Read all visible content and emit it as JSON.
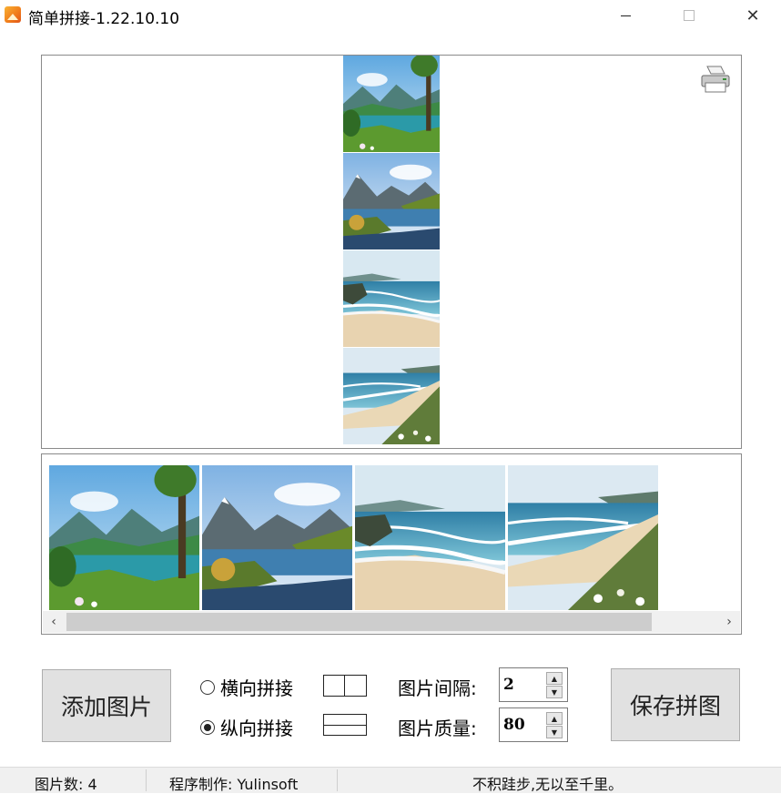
{
  "window": {
    "title": "简单拼接-1.22.10.10",
    "controls": {
      "minimize_icon": "minimize-icon",
      "maximize_icon": "maximize-icon",
      "close_icon": "close-icon",
      "close_glyph": "✕"
    }
  },
  "preview": {
    "print_icon": "printer-icon",
    "tiles": [
      {
        "name": "lake-with-trees"
      },
      {
        "name": "mountain-river"
      },
      {
        "name": "beach-waves"
      },
      {
        "name": "coastal-beach"
      }
    ]
  },
  "thumbnails": {
    "items": [
      {
        "name": "lake-with-trees"
      },
      {
        "name": "mountain-river"
      },
      {
        "name": "beach-waves"
      },
      {
        "name": "coastal-beach"
      }
    ],
    "scroll_left": "‹",
    "scroll_right": "›"
  },
  "controls": {
    "add_button": "添加图片",
    "save_button": "保存拼图",
    "horizontal_label": "横向拼接",
    "vertical_label": "纵向拼接",
    "selected_mode": "vertical",
    "gap_label": "图片间隔:",
    "gap_value": "2",
    "quality_label": "图片质量:",
    "quality_value": "80",
    "spin_up": "▲",
    "spin_down": "▼"
  },
  "status": {
    "count": "图片数: 4",
    "author": "程序制作: Yulinsoft",
    "motto": "不积跬步,无以至千里。"
  },
  "colors": {
    "accent": "#f07a1a",
    "button_face": "#e1e1e1",
    "status_bg": "#f0f0f0"
  }
}
